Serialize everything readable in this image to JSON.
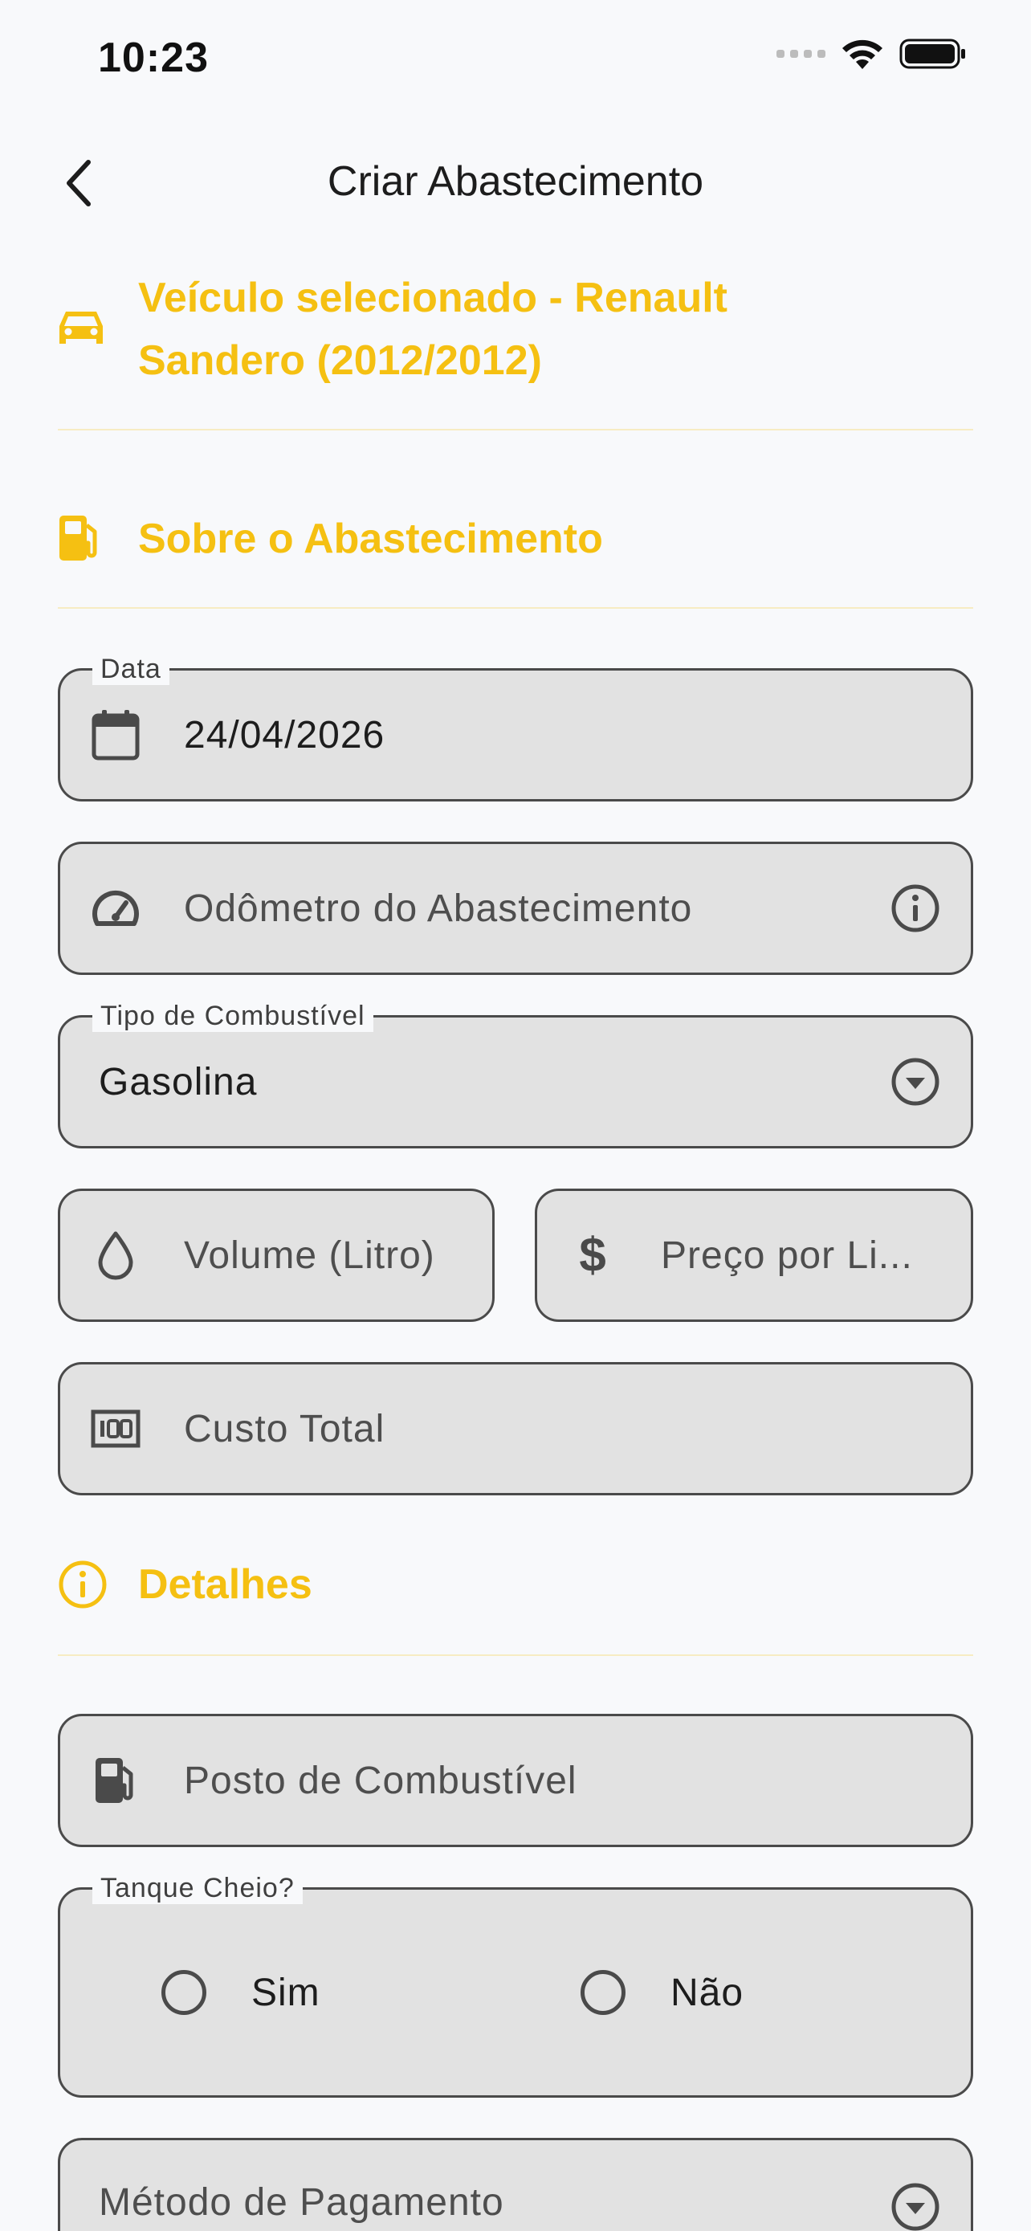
{
  "status_bar": {
    "time": "10:23"
  },
  "header": {
    "title": "Criar Abastecimento"
  },
  "vehicle": {
    "text": "Veículo selecionado - Renault Sandero (2012/2012)"
  },
  "section_about": {
    "title": "Sobre o Abastecimento"
  },
  "fields": {
    "date": {
      "label": "Data",
      "value": "24/04/2026"
    },
    "odometer": {
      "placeholder": "Odômetro do Abastecimento"
    },
    "fuel_type": {
      "label": "Tipo de Combustível",
      "value": "Gasolina"
    },
    "volume": {
      "placeholder": "Volume (Litro)"
    },
    "price": {
      "placeholder": "Preço por Li..."
    },
    "total": {
      "placeholder": "Custo Total"
    }
  },
  "section_details": {
    "title": "Detalhes"
  },
  "details": {
    "station": {
      "placeholder": "Posto de Combustível"
    },
    "full_tank": {
      "label": "Tanque Cheio?",
      "options": [
        "Sim",
        "Não"
      ]
    },
    "payment": {
      "placeholder": "Método de Pagamento"
    }
  },
  "colors": {
    "accent": "#f5c012",
    "field_bg": "#e2e2e2",
    "border": "#4a4a4a",
    "background": "#f8f9fb"
  }
}
